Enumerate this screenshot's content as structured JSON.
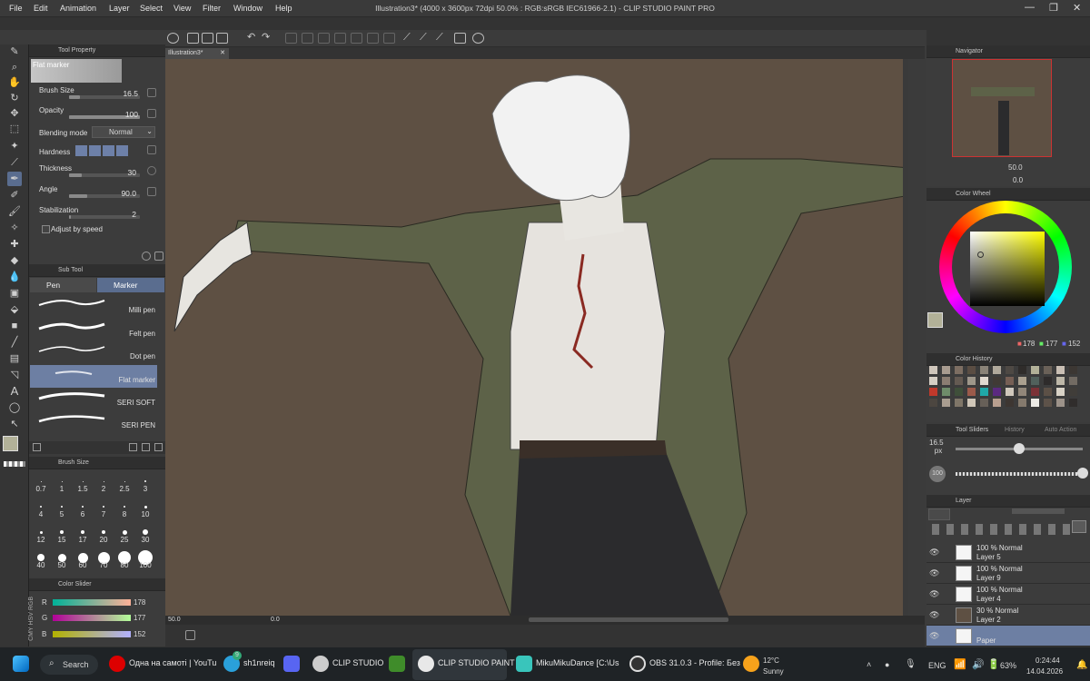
{
  "window": {
    "title": "Illustration3* (4000 x 3600px 72dpi 50.0% : RGB:sRGB IEC61966-2.1)  - CLIP STUDIO PAINT PRO",
    "menu": [
      "File",
      "Edit",
      "Animation",
      "Layer",
      "Select",
      "View",
      "Filter",
      "Window",
      "Help"
    ]
  },
  "tool_property": {
    "panel_title": "Tool Property",
    "tool_name": "Flat marker",
    "brush_size_label": "Brush Size",
    "brush_size_value": "16.5",
    "brush_size_level": 0.16,
    "opacity_label": "Opacity",
    "opacity_value": "100",
    "opacity_level": 1.0,
    "blending_label": "Blending mode",
    "blending_value": "Normal",
    "hardness_label": "Hardness",
    "thickness_label": "Thickness",
    "thickness_value": "30",
    "angle_label": "Angle",
    "angle_value": "90.0",
    "stabilization_label": "Stabilization",
    "stabilization_value": "2",
    "adjust_label": "Adjust by speed"
  },
  "sub_tool": {
    "panel_title": "Sub Tool",
    "tab_pen": "Pen",
    "tab_marker": "Marker",
    "items": [
      "Milli pen",
      "Felt pen",
      "Dot pen",
      "Flat marker",
      "SERI SOFT",
      "SERI PEN"
    ]
  },
  "brush_size_panel": {
    "title": "Brush Size",
    "sizes": [
      "0.7",
      "1",
      "1.5",
      "2",
      "2.5",
      "3",
      "4",
      "5",
      "6",
      "7",
      "8",
      "10",
      "12",
      "15",
      "17",
      "20",
      "25",
      "30",
      "40",
      "50",
      "60",
      "70",
      "80",
      "100"
    ]
  },
  "color_slider": {
    "title": "Color Slider",
    "modes": "CMY HSV RGB",
    "r_label": "R",
    "r_value": "178",
    "g_label": "G",
    "g_value": "177",
    "b_label": "B",
    "b_value": "152"
  },
  "canvas": {
    "tab": "Illustration3*",
    "zoom": "50.0",
    "rotate": "0.0"
  },
  "navigator": {
    "title": "Navigator",
    "zoom": "50.0",
    "rotation": "0.0"
  },
  "color_wheel": {
    "title": "Color Wheel",
    "r": "178",
    "g": "177",
    "b": "152",
    "current_color": "#b2b198"
  },
  "color_history": {
    "title": "Color History",
    "swatches": [
      "#cfc6bb",
      "#a89b8f",
      "#7d6e62",
      "#5a4d43",
      "#8a8378",
      "#b0a99b",
      "#4e4944",
      "#2f2c2a",
      "#b2b198",
      "#6a6158",
      "#c9bfb4",
      "#3c3733",
      "#d6cfc5",
      "#8b7d72",
      "#645a52",
      "#9e978a",
      "#e1dad0",
      "#403a35",
      "#765f55",
      "#aaa08f",
      "#51615c",
      "#2e2b2b",
      "#bdb7a8",
      "#726b63",
      "#c0392b",
      "#6f8c6a",
      "#3f4f3a",
      "#9b5a4a",
      "#1fa8a8",
      "#5b2a80",
      "#d0c8bc",
      "#918679",
      "#7b3236",
      "#5c5046",
      "#d8d2c6",
      "#403d39",
      "#4c4640",
      "#a99d90",
      "#7f7668",
      "#cfc6b8",
      "#676058",
      "#b89f8f",
      "#3d3632",
      "#857a6d",
      "#edebe5",
      "#5d5249",
      "#9d938a",
      "#302d2c"
    ]
  },
  "tool_sliders": {
    "title": "Tool Sliders",
    "tab2": "History",
    "tab3": "Auto Action",
    "size_value": "16.5",
    "size_unit": "px",
    "size_level": 0.16,
    "opacity_value": "100",
    "opacity_level": 1.0
  },
  "layers": {
    "title": "Layer",
    "rows": [
      {
        "mode": "100 % Normal",
        "name": "Layer 5"
      },
      {
        "mode": "100 % Normal",
        "name": "Layer 9"
      },
      {
        "mode": "100 % Normal",
        "name": "Layer 4"
      },
      {
        "mode": "30 % Normal",
        "name": "Layer 2"
      },
      {
        "mode": "",
        "name": "Paper"
      }
    ]
  },
  "taskbar": {
    "search": "Search",
    "items": [
      "Одна на самоті | YouTu",
      "sh1nreiq",
      "CLIP STUDIO",
      "CLIP STUDIO PAINT",
      "MikuMikuDance [C:\\Us",
      "OBS 31.0.3 - Profile: Без"
    ],
    "weather_temp": "12°C",
    "weather_desc": "Sunny",
    "lang": "ENG",
    "battery": "63%",
    "time": "0:24:44",
    "date": "14.04.2026",
    "badge": "9"
  }
}
